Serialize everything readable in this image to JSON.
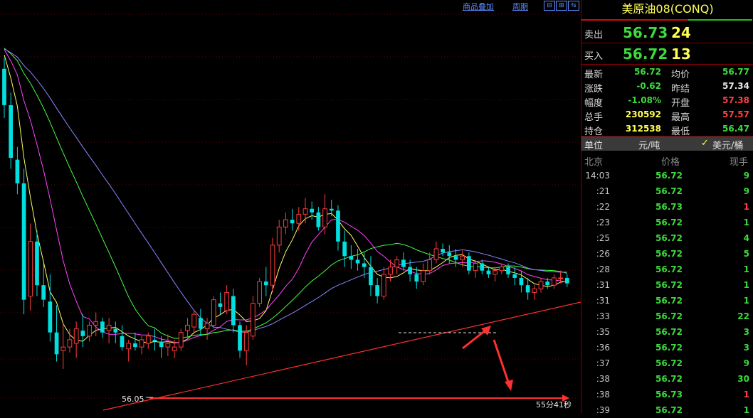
{
  "toolbar": {
    "overlay_label": "商品叠加",
    "period_label": "周期"
  },
  "chart": {
    "low_label": "56.05",
    "countdown": "55分41秒"
  },
  "chart_data": {
    "type": "candlestick",
    "y_range": [
      55.9,
      58.05
    ],
    "candles": [
      [
        57.75,
        57.81,
        57.48,
        57.55
      ],
      [
        57.55,
        57.62,
        57.2,
        57.26
      ],
      [
        57.25,
        57.32,
        57.06,
        57.12
      ],
      [
        57.12,
        57.2,
        56.4,
        56.48
      ],
      [
        56.5,
        56.9,
        56.42,
        56.8
      ],
      [
        56.8,
        56.86,
        56.5,
        56.56
      ],
      [
        56.56,
        56.68,
        56.44,
        56.48
      ],
      [
        56.47,
        56.62,
        56.25,
        56.3
      ],
      [
        56.3,
        56.45,
        56.14,
        56.18
      ],
      [
        56.2,
        56.35,
        56.1,
        56.22
      ],
      [
        56.22,
        56.32,
        56.19,
        56.26
      ],
      [
        56.24,
        56.36,
        56.16,
        56.32
      ],
      [
        56.31,
        56.4,
        56.22,
        56.28
      ],
      [
        56.28,
        56.36,
        56.25,
        56.34
      ],
      [
        56.34,
        56.41,
        56.28,
        56.36
      ],
      [
        56.36,
        56.38,
        56.27,
        56.3
      ],
      [
        56.31,
        56.38,
        56.24,
        56.34
      ],
      [
        56.32,
        56.36,
        56.24,
        56.3
      ],
      [
        56.28,
        56.34,
        56.2,
        56.22
      ],
      [
        56.21,
        56.26,
        56.14,
        56.24
      ],
      [
        56.24,
        56.3,
        56.2,
        56.22
      ],
      [
        56.22,
        56.28,
        56.18,
        56.26
      ],
      [
        56.24,
        56.3,
        56.21,
        56.28
      ],
      [
        56.26,
        56.32,
        56.2,
        56.25
      ],
      [
        56.25,
        56.28,
        56.16,
        56.22
      ],
      [
        56.22,
        56.29,
        56.17,
        56.24
      ],
      [
        56.2,
        56.26,
        56.16,
        56.22
      ],
      [
        56.22,
        56.32,
        56.2,
        56.3
      ],
      [
        56.31,
        56.38,
        56.26,
        56.34
      ],
      [
        56.33,
        56.42,
        56.29,
        56.4
      ],
      [
        56.38,
        56.43,
        56.28,
        56.32
      ],
      [
        56.32,
        56.38,
        56.26,
        56.35
      ],
      [
        56.34,
        56.5,
        56.32,
        56.48
      ],
      [
        56.46,
        56.52,
        56.4,
        56.44
      ],
      [
        56.42,
        56.56,
        56.4,
        56.52
      ],
      [
        56.5,
        56.54,
        56.3,
        56.34
      ],
      [
        56.34,
        56.36,
        56.16,
        56.2
      ],
      [
        56.2,
        56.34,
        56.12,
        56.3
      ],
      [
        56.28,
        56.5,
        56.26,
        56.46
      ],
      [
        56.46,
        56.6,
        56.44,
        56.58
      ],
      [
        56.58,
        56.66,
        56.5,
        56.56
      ],
      [
        56.56,
        56.82,
        56.52,
        56.78
      ],
      [
        56.78,
        56.92,
        56.74,
        56.88
      ],
      [
        56.88,
        56.96,
        56.84,
        56.92
      ],
      [
        56.92,
        56.98,
        56.86,
        56.9
      ],
      [
        56.9,
        56.99,
        56.86,
        56.95
      ],
      [
        56.95,
        57.04,
        56.9,
        56.98
      ],
      [
        56.98,
        57.02,
        56.92,
        56.96
      ],
      [
        56.96,
        56.99,
        56.86,
        56.88
      ],
      [
        56.88,
        57.06,
        56.84,
        56.98
      ],
      [
        56.98,
        57.03,
        56.94,
        56.97
      ],
      [
        56.97,
        57.0,
        56.75,
        56.8
      ],
      [
        56.8,
        56.86,
        56.66,
        56.72
      ],
      [
        56.72,
        56.78,
        56.65,
        56.7
      ],
      [
        56.7,
        56.76,
        56.64,
        56.68
      ],
      [
        56.68,
        56.74,
        56.6,
        56.66
      ],
      [
        56.66,
        56.72,
        56.5,
        56.56
      ],
      [
        56.56,
        56.6,
        56.46,
        56.5
      ],
      [
        56.5,
        56.66,
        56.48,
        56.62
      ],
      [
        56.62,
        56.7,
        56.58,
        56.66
      ],
      [
        56.66,
        56.72,
        56.62,
        56.7
      ],
      [
        56.7,
        56.74,
        56.64,
        56.66
      ],
      [
        56.66,
        56.7,
        56.58,
        56.62
      ],
      [
        56.62,
        56.66,
        56.54,
        56.58
      ],
      [
        56.58,
        56.68,
        56.56,
        56.64
      ],
      [
        56.64,
        56.74,
        56.62,
        56.7
      ],
      [
        56.7,
        56.8,
        56.68,
        56.76
      ],
      [
        56.76,
        56.79,
        56.72,
        56.74
      ],
      [
        56.74,
        56.78,
        56.68,
        56.72
      ],
      [
        56.72,
        56.76,
        56.66,
        56.7
      ],
      [
        56.7,
        56.75,
        56.66,
        56.72
      ],
      [
        56.72,
        56.74,
        56.62,
        56.64
      ],
      [
        56.64,
        56.7,
        56.6,
        56.68
      ],
      [
        56.68,
        56.7,
        56.62,
        56.64
      ],
      [
        56.64,
        56.66,
        56.6,
        56.62
      ],
      [
        56.62,
        56.66,
        56.58,
        56.64
      ],
      [
        56.64,
        56.68,
        56.62,
        56.66
      ],
      [
        56.66,
        56.68,
        56.6,
        56.62
      ],
      [
        56.62,
        56.66,
        56.56,
        56.6
      ],
      [
        56.6,
        56.64,
        56.52,
        56.56
      ],
      [
        56.56,
        56.6,
        56.48,
        56.52
      ],
      [
        56.52,
        56.56,
        56.48,
        56.54
      ],
      [
        56.54,
        56.6,
        56.52,
        56.58
      ],
      [
        56.58,
        56.6,
        56.54,
        56.56
      ],
      [
        56.56,
        56.62,
        56.54,
        56.6
      ],
      [
        56.6,
        56.64,
        56.57,
        56.6
      ],
      [
        56.6,
        56.62,
        56.55,
        56.57
      ]
    ],
    "ma_series": [
      {
        "color": "#ffff66",
        "period": 5
      },
      {
        "color": "#ff44ff",
        "period": 10
      },
      {
        "color": "#44ff44",
        "period": 20
      },
      {
        "color": "#8888ff",
        "period": 30
      }
    ]
  },
  "panel": {
    "title": "美原油08(CONQ)",
    "sell": {
      "label": "卖出",
      "price": "56.73",
      "vol": "24"
    },
    "buy": {
      "label": "买入",
      "price": "56.72",
      "vol": "13"
    },
    "stats": [
      {
        "l1": "最新",
        "v1": "56.72",
        "c1": "green",
        "l2": "均价",
        "v2": "56.77",
        "c2": "green"
      },
      {
        "l1": "涨跌",
        "v1": "-0.62",
        "c1": "green",
        "l2": "昨结",
        "v2": "57.34",
        "c2": "white"
      },
      {
        "l1": "幅度",
        "v1": "-1.08%",
        "c1": "green",
        "l2": "开盘",
        "v2": "57.38",
        "c2": "red"
      },
      {
        "l1": "总手",
        "v1": "230592",
        "c1": "yellow",
        "l2": "最高",
        "v2": "57.57",
        "c2": "red"
      },
      {
        "l1": "持仓",
        "v1": "312538",
        "c1": "yellow",
        "l2": "最低",
        "v2": "56.47",
        "c2": "green"
      }
    ],
    "unit": {
      "label": "单位",
      "opt1": "元/吨",
      "opt2": "美元/桶"
    },
    "trade_header": {
      "time": "北京",
      "price": "价格",
      "vol": "现手"
    },
    "trades": [
      {
        "time": "14:03",
        "price": "56.72",
        "vol": "9",
        "c": "green"
      },
      {
        "time": ":21",
        "price": "56.72",
        "vol": "9",
        "c": "green"
      },
      {
        "time": ":22",
        "price": "56.73",
        "vol": "1",
        "c": "red"
      },
      {
        "time": ":23",
        "price": "56.72",
        "vol": "1",
        "c": "green"
      },
      {
        "time": ":25",
        "price": "56.72",
        "vol": "4",
        "c": "green"
      },
      {
        "time": ":26",
        "price": "56.72",
        "vol": "5",
        "c": "green"
      },
      {
        "time": ":28",
        "price": "56.72",
        "vol": "1",
        "c": "green"
      },
      {
        "time": ":31",
        "price": "56.72",
        "vol": "1",
        "c": "green"
      },
      {
        "time": ":31",
        "price": "56.72",
        "vol": "1",
        "c": "green"
      },
      {
        "time": ":33",
        "price": "56.72",
        "vol": "22",
        "c": "green"
      },
      {
        "time": ":35",
        "price": "56.72",
        "vol": "3",
        "c": "green"
      },
      {
        "time": ":36",
        "price": "56.72",
        "vol": "3",
        "c": "green"
      },
      {
        "time": ":37",
        "price": "56.72",
        "vol": "9",
        "c": "green"
      },
      {
        "time": ":38",
        "price": "56.72",
        "vol": "30",
        "c": "green"
      },
      {
        "time": ":38",
        "price": "56.73",
        "vol": "1",
        "c": "red"
      },
      {
        "time": ":39",
        "price": "56.72",
        "vol": "1",
        "c": "green"
      }
    ]
  }
}
